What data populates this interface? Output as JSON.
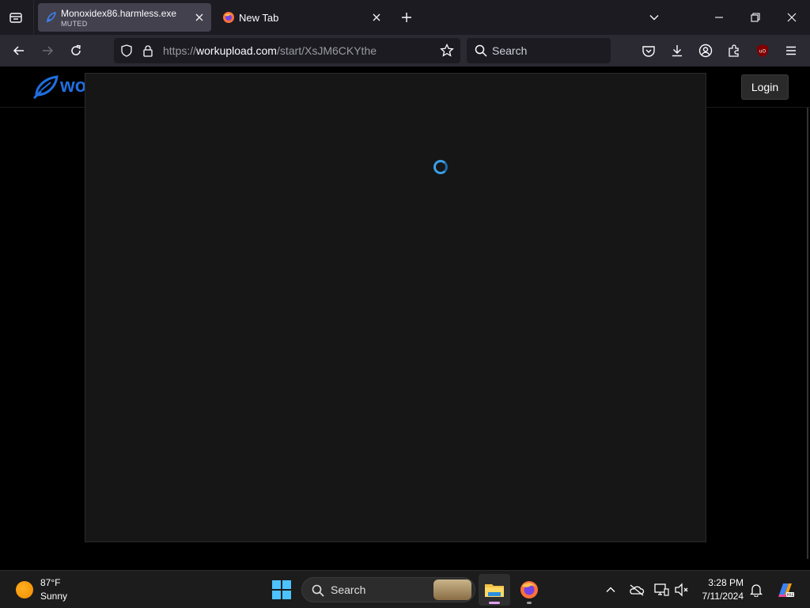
{
  "browser": {
    "tabs": [
      {
        "title": "Monoxidex86.harmless.exe",
        "subtitle": "MUTED",
        "active": true
      },
      {
        "title": "New Tab",
        "active": false
      }
    ],
    "url": {
      "prefix": "https://",
      "host": "workupload.com",
      "path": "/start/XsJM6CKYthe"
    },
    "search_placeholder": "Search"
  },
  "page": {
    "logo_text": "wo",
    "login_label": "Login",
    "modal_state": "loading"
  },
  "taskbar": {
    "weather": {
      "temp": "87°F",
      "desc": "Sunny"
    },
    "search_label": "Search",
    "clock": {
      "time": "3:28 PM",
      "date": "7/11/2024"
    }
  },
  "colors": {
    "accent": "#3a9fe6",
    "logo": "#1f6fe0",
    "start": "#4cc2ff"
  }
}
